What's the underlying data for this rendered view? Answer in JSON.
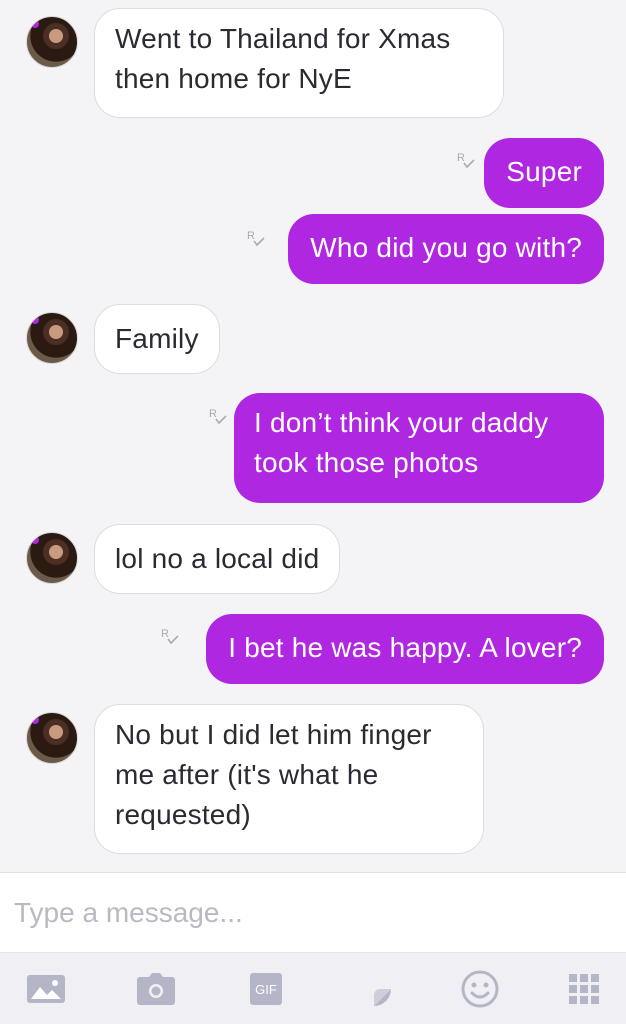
{
  "messages": [
    {
      "direction": "incoming",
      "text": "Went to Thailand for Xmas then home for NyE"
    },
    {
      "direction": "outgoing",
      "text": "Super",
      "receipt": "R"
    },
    {
      "direction": "outgoing",
      "text": "Who did you go with?",
      "receipt": "R"
    },
    {
      "direction": "incoming",
      "text": "Family"
    },
    {
      "direction": "outgoing",
      "text": "I don’t think your daddy took those photos",
      "receipt": "R"
    },
    {
      "direction": "incoming",
      "text": "lol no a local did"
    },
    {
      "direction": "outgoing",
      "text": "I bet he was happy. A lover?",
      "receipt": "R"
    },
    {
      "direction": "incoming",
      "text": "No but I did let him finger me after (it's what he requested)"
    }
  ],
  "composer": {
    "placeholder": "Type a message..."
  },
  "toolbar": {
    "items": [
      {
        "icon": "image-icon"
      },
      {
        "icon": "camera-icon"
      },
      {
        "icon": "gif-icon",
        "label": "GIF"
      },
      {
        "icon": "sticker-icon"
      },
      {
        "icon": "emoji-icon"
      },
      {
        "icon": "apps-grid-icon"
      }
    ]
  },
  "colors": {
    "outgoing_bubble": "#b027e2",
    "incoming_bubble": "#ffffff",
    "background": "#f4f4f6",
    "icon": "#b5b5c8"
  }
}
